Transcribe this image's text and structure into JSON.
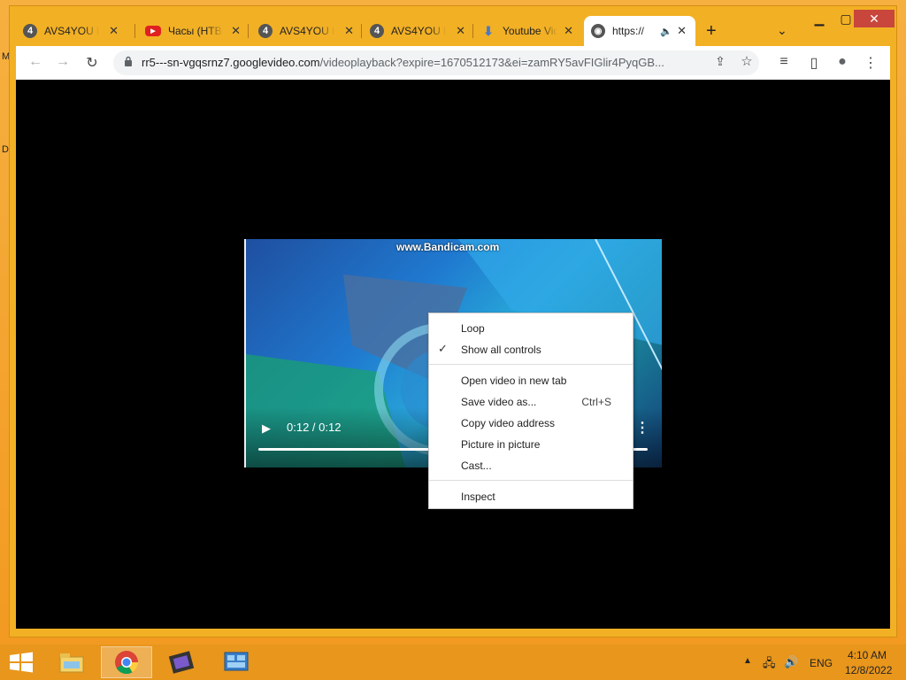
{
  "desktop": {
    "left_letters": [
      "M",
      "D"
    ]
  },
  "window": {
    "minimize": "▁",
    "maximize": "▢",
    "close": "✕"
  },
  "tabs": [
    {
      "icon": "avs4you-icon",
      "fav": "4",
      "title": "AVS4YOU b"
    },
    {
      "icon": "youtube-icon",
      "fav": "▶",
      "title": "Часы (НТВ"
    },
    {
      "icon": "avs4you-icon",
      "fav": "4",
      "title": "AVS4YOU b"
    },
    {
      "icon": "avs4you-icon",
      "fav": "4",
      "title": "AVS4YOU b"
    },
    {
      "icon": "download-icon",
      "fav": "⬇",
      "title": "Youtube Vic"
    },
    {
      "icon": "globe-icon",
      "fav": "◉",
      "title": "https://",
      "audio": "🔈",
      "active": true
    }
  ],
  "tab_close": "✕",
  "new_tab": "+",
  "tab_search": "⌄",
  "toolbar": {
    "back": "←",
    "forward": "→",
    "reload": "↻",
    "url_host": "rr5---sn-vgqsrnz7.googlevideo.com",
    "url_rest": "/videoplayback?expire=1670512173&ei=zamRY5avFIGlir4PyqGB...",
    "share": "⇪",
    "bookmark": "☆",
    "media": "≡",
    "sidepanel": "▯",
    "profile": "●",
    "menu": "⋮"
  },
  "video": {
    "watermark": "www.Bandicam.com",
    "play": "▶",
    "time": "0:12 / 0:12",
    "more": "⋮",
    "progress_fraction": 1.0
  },
  "context_menu": {
    "items": [
      {
        "label": "Loop",
        "checked": false,
        "shortcut": ""
      },
      {
        "label": "Show all controls",
        "checked": true,
        "shortcut": ""
      },
      {
        "label": "Open video in new tab",
        "checked": false,
        "shortcut": ""
      },
      {
        "label": "Save video as...",
        "checked": false,
        "shortcut": "Ctrl+S"
      },
      {
        "label": "Copy video address",
        "checked": false,
        "shortcut": ""
      },
      {
        "label": "Picture in picture",
        "checked": false,
        "shortcut": ""
      },
      {
        "label": "Cast...",
        "checked": false,
        "shortcut": ""
      },
      {
        "label": "Inspect",
        "checked": false,
        "shortcut": ""
      }
    ],
    "check_glyph": "✓"
  },
  "taskbar": {
    "apps": [
      "file-explorer-icon",
      "chrome-icon",
      "movie-maker-icon",
      "control-panel-icon"
    ],
    "tray_arrow": "▲",
    "language": "ENG",
    "time": "4:10 AM",
    "date": "12/8/2022"
  },
  "colors": {
    "taskbar": "#e8961c",
    "frame": "#f2b024",
    "close": "#c9463d"
  }
}
